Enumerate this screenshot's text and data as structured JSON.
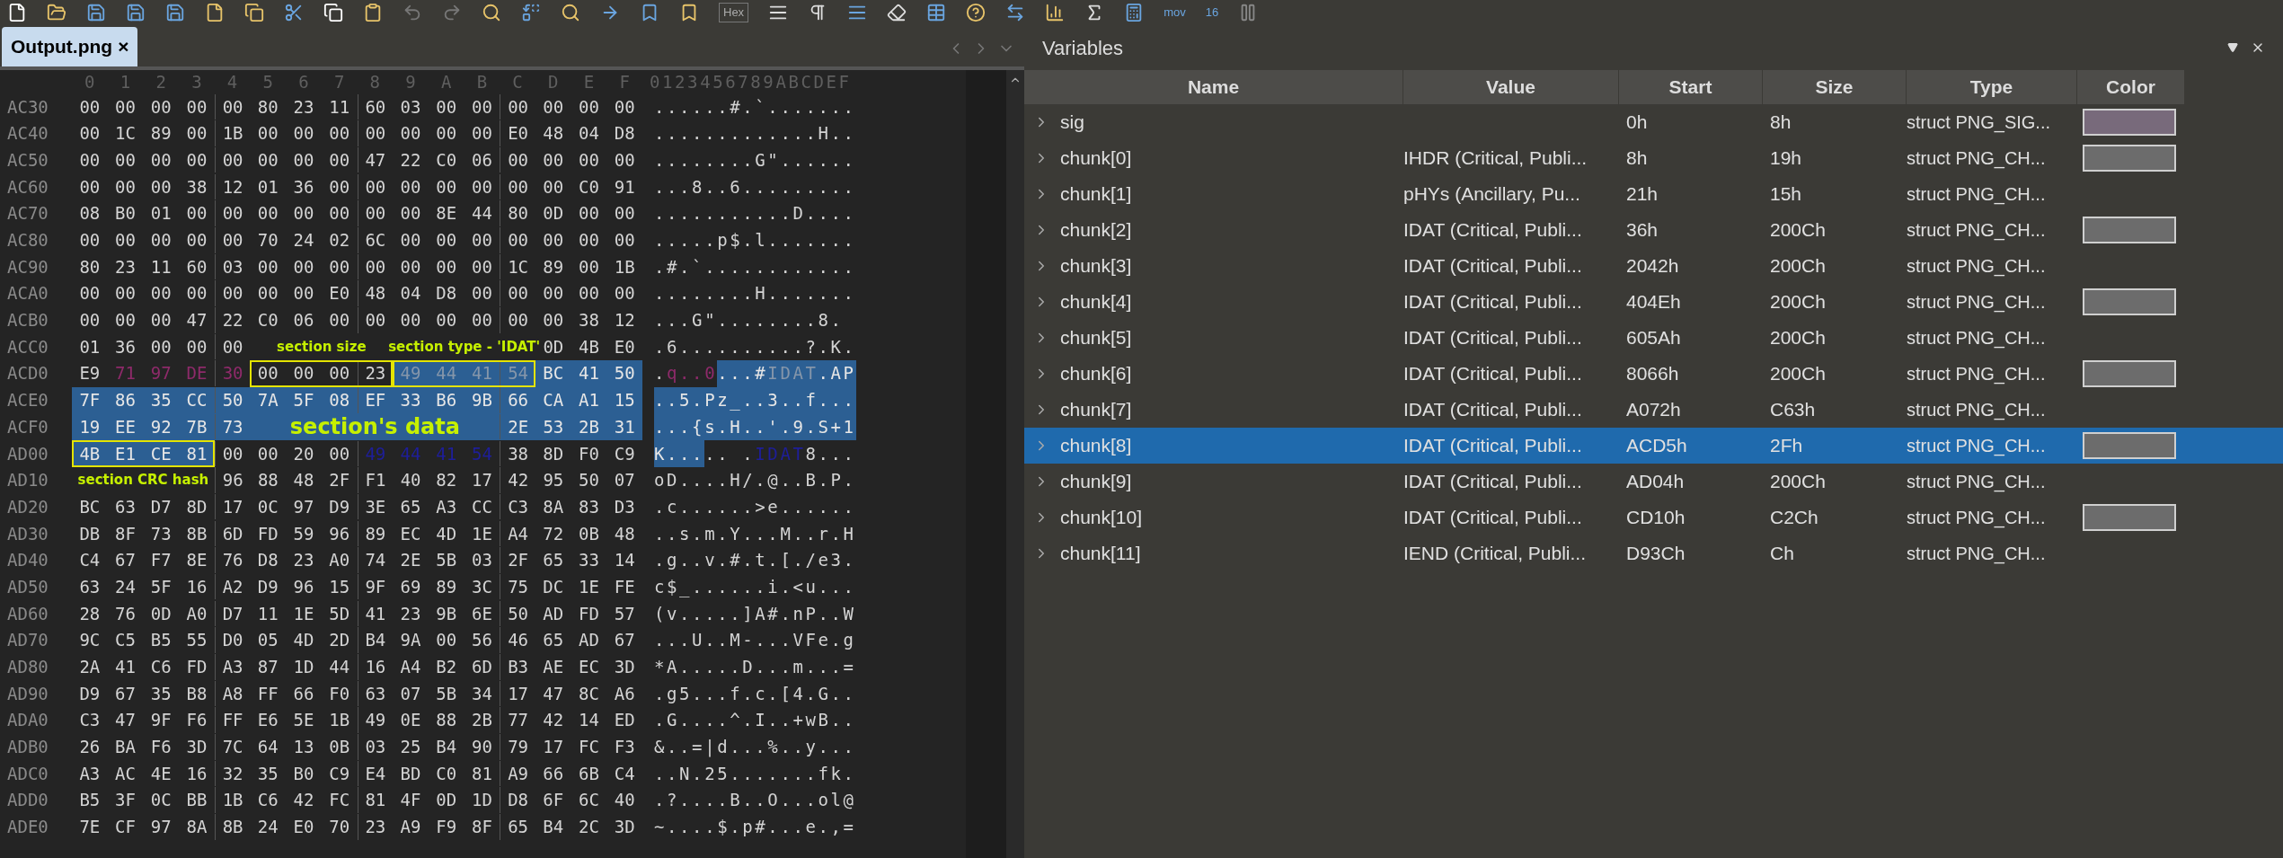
{
  "toolbar": {
    "labels": [
      "Hex",
      "mov",
      "16"
    ]
  },
  "tab": {
    "label": "Output.png",
    "close": "×",
    "selected": true
  },
  "hex_view": {
    "columns": [
      "0",
      "1",
      "2",
      "3",
      "4",
      "5",
      "6",
      "7",
      "8",
      "9",
      "A",
      "B",
      "C",
      "D",
      "E",
      "F"
    ],
    "ascii_header": "0123456789ABCDEF",
    "rows": [
      {
        "offset": "AC30",
        "segments": [
          {
            "kind": "plain",
            "bytes": [
              "00",
              "00",
              "00",
              "00",
              "00",
              "80",
              "23",
              "11",
              "60",
              "03",
              "00",
              "00",
              "00",
              "00",
              "00",
              "00"
            ]
          }
        ],
        "ascii": [
          {
            "kind": "plain",
            "text": "......#.`......."
          }
        ]
      },
      {
        "offset": "AC40",
        "segments": [
          {
            "kind": "plain",
            "bytes": [
              "00",
              "1C",
              "89",
              "00",
              "1B",
              "00",
              "00",
              "00",
              "00",
              "00",
              "00",
              "00",
              "E0",
              "48",
              "04",
              "D8"
            ]
          }
        ],
        "ascii": [
          {
            "kind": "plain",
            "text": ".............H.."
          }
        ]
      },
      {
        "offset": "AC50",
        "segments": [
          {
            "kind": "plain",
            "bytes": [
              "00",
              "00",
              "00",
              "00",
              "00",
              "00",
              "00",
              "00",
              "47",
              "22",
              "C0",
              "06",
              "00",
              "00",
              "00",
              "00"
            ]
          }
        ],
        "ascii": [
          {
            "kind": "plain",
            "text": "........G\"......"
          }
        ]
      },
      {
        "offset": "AC60",
        "segments": [
          {
            "kind": "plain",
            "bytes": [
              "00",
              "00",
              "00",
              "38",
              "12",
              "01",
              "36",
              "00",
              "00",
              "00",
              "00",
              "00",
              "00",
              "00",
              "C0",
              "91"
            ]
          }
        ],
        "ascii": [
          {
            "kind": "plain",
            "text": "...8..6........."
          }
        ]
      },
      {
        "offset": "AC70",
        "segments": [
          {
            "kind": "plain",
            "bytes": [
              "08",
              "B0",
              "01",
              "00",
              "00",
              "00",
              "00",
              "00",
              "00",
              "00",
              "8E",
              "44",
              "80",
              "0D",
              "00",
              "00"
            ]
          }
        ],
        "ascii": [
          {
            "kind": "plain",
            "text": "...........D...."
          }
        ]
      },
      {
        "offset": "AC80",
        "segments": [
          {
            "kind": "plain",
            "bytes": [
              "00",
              "00",
              "00",
              "00",
              "00",
              "70",
              "24",
              "02",
              "6C",
              "00",
              "00",
              "00",
              "00",
              "00",
              "00",
              "00"
            ]
          }
        ],
        "ascii": [
          {
            "kind": "plain",
            "text": ".....p$.l......."
          }
        ]
      },
      {
        "offset": "AC90",
        "segments": [
          {
            "kind": "plain",
            "bytes": [
              "80",
              "23",
              "11",
              "60",
              "03",
              "00",
              "00",
              "00",
              "00",
              "00",
              "00",
              "00",
              "1C",
              "89",
              "00",
              "1B"
            ]
          }
        ],
        "ascii": [
          {
            "kind": "plain",
            "text": ".#.`............"
          }
        ]
      },
      {
        "offset": "ACA0",
        "segments": [
          {
            "kind": "plain",
            "bytes": [
              "00",
              "00",
              "00",
              "00",
              "00",
              "00",
              "00",
              "E0",
              "48",
              "04",
              "D8",
              "00",
              "00",
              "00",
              "00",
              "00"
            ]
          }
        ],
        "ascii": [
          {
            "kind": "plain",
            "text": "........H......."
          }
        ]
      },
      {
        "offset": "ACB0",
        "segments": [
          {
            "kind": "plain",
            "bytes": [
              "00",
              "00",
              "00",
              "47",
              "22",
              "C0",
              "06",
              "00",
              "00",
              "00",
              "00",
              "00",
              "00",
              "00",
              "38",
              "12"
            ]
          }
        ],
        "ascii": [
          {
            "kind": "plain",
            "text": "...G\"........8."
          }
        ]
      },
      {
        "offset": "ACC0",
        "segments": [
          {
            "kind": "plain",
            "bytes": [
              "01",
              "36",
              "00",
              "00",
              "00"
            ]
          },
          {
            "kind": "label",
            "text": "section size"
          },
          {
            "kind": "label",
            "text": "section type - 'IDAT'"
          },
          {
            "kind": "plain",
            "bytes": [
              "0D",
              "4B",
              "E0"
            ]
          }
        ],
        "ascii": [
          {
            "kind": "plain",
            "text": ".6..........?.K."
          }
        ]
      },
      {
        "offset": "ACD0",
        "segments": [
          {
            "kind": "plain",
            "bytes": [
              "E9"
            ]
          },
          {
            "kind": "tagged",
            "bytes": [
              "71",
              "97",
              "DE",
              "30"
            ]
          },
          {
            "kind": "plain",
            "boxed": true,
            "bytes": [
              "00",
              "00",
              "00",
              "23"
            ]
          },
          {
            "kind": "selected-dim",
            "boxed": true,
            "bytes": [
              "49",
              "44",
              "41",
              "54"
            ]
          },
          {
            "kind": "selected",
            "bytes": [
              "BC",
              "41",
              "50"
            ]
          }
        ],
        "ascii": [
          {
            "kind": "plain",
            "text": "."
          },
          {
            "kind": "tagged",
            "text": "q..0"
          },
          {
            "kind": "selected",
            "text": "...#"
          },
          {
            "kind": "selected-dim",
            "text": "IDAT"
          },
          {
            "kind": "selected",
            "text": ".AP"
          }
        ]
      },
      {
        "offset": "ACE0",
        "segments": [
          {
            "kind": "selected",
            "bytes": [
              "7F",
              "86",
              "35",
              "CC",
              "50",
              "7A",
              "5F",
              "08",
              "EF",
              "33",
              "B6",
              "9B",
              "66",
              "CA",
              "A1",
              "15"
            ]
          }
        ],
        "ascii": [
          {
            "kind": "selected",
            "text": "..5.Pz_..3..f..."
          }
        ]
      },
      {
        "offset": "ACF0",
        "segments": [
          {
            "kind": "selected",
            "bytes": [
              "19",
              "EE",
              "92",
              "7B",
              "73"
            ]
          },
          {
            "kind": "label-large",
            "text": "section's data"
          },
          {
            "kind": "selected",
            "bytes": [
              "2E",
              "53",
              "2B",
              "31"
            ]
          }
        ],
        "ascii": [
          {
            "kind": "selected",
            "text": "...{s.H..'.9.S+1"
          }
        ]
      },
      {
        "offset": "AD00",
        "segments": [
          {
            "kind": "selected",
            "boxed": true,
            "bytes": [
              "4B",
              "E1",
              "CE",
              "81"
            ]
          },
          {
            "kind": "plain",
            "bytes": [
              "00",
              "00",
              "20",
              "00"
            ]
          },
          {
            "kind": "marked",
            "bytes": [
              "49",
              "44",
              "41",
              "54"
            ]
          },
          {
            "kind": "plain",
            "bytes": [
              "38",
              "8D",
              "F0",
              "C9"
            ]
          }
        ],
        "ascii": [
          {
            "kind": "selected",
            "text": "K..."
          },
          {
            "kind": "plain",
            "text": ".. ."
          },
          {
            "kind": "marked",
            "text": "IDAT"
          },
          {
            "kind": "plain",
            "text": "8..."
          }
        ]
      },
      {
        "offset": "AD10",
        "segments": [
          {
            "kind": "label",
            "text": "section CRC hash"
          },
          {
            "kind": "plain",
            "bytes": [
              "96",
              "88",
              "48",
              "2F",
              "F1",
              "40",
              "82",
              "17",
              "42",
              "95",
              "50",
              "07"
            ]
          }
        ],
        "ascii": [
          {
            "kind": "plain",
            "text": "oD....H/.@..B.P."
          }
        ]
      },
      {
        "offset": "AD20",
        "segments": [
          {
            "kind": "plain",
            "bytes": [
              "BC",
              "63",
              "D7",
              "8D",
              "17",
              "0C",
              "97",
              "D9",
              "3E",
              "65",
              "A3",
              "CC",
              "C3",
              "8A",
              "83",
              "D3"
            ]
          }
        ],
        "ascii": [
          {
            "kind": "plain",
            "text": ".c......>e......"
          }
        ]
      },
      {
        "offset": "AD30",
        "segments": [
          {
            "kind": "plain",
            "bytes": [
              "DB",
              "8F",
              "73",
              "8B",
              "6D",
              "FD",
              "59",
              "96",
              "89",
              "EC",
              "4D",
              "1E",
              "A4",
              "72",
              "0B",
              "48"
            ]
          }
        ],
        "ascii": [
          {
            "kind": "plain",
            "text": "..s.m.Y...M..r.H"
          }
        ]
      },
      {
        "offset": "AD40",
        "segments": [
          {
            "kind": "plain",
            "bytes": [
              "C4",
              "67",
              "F7",
              "8E",
              "76",
              "D8",
              "23",
              "A0",
              "74",
              "2E",
              "5B",
              "03",
              "2F",
              "65",
              "33",
              "14"
            ]
          }
        ],
        "ascii": [
          {
            "kind": "plain",
            "text": ".g..v.#.t.[./e3."
          }
        ]
      },
      {
        "offset": "AD50",
        "segments": [
          {
            "kind": "plain",
            "bytes": [
              "63",
              "24",
              "5F",
              "16",
              "A2",
              "D9",
              "96",
              "15",
              "9F",
              "69",
              "89",
              "3C",
              "75",
              "DC",
              "1E",
              "FE"
            ]
          }
        ],
        "ascii": [
          {
            "kind": "plain",
            "text": "c$_......i.<u..."
          }
        ]
      },
      {
        "offset": "AD60",
        "segments": [
          {
            "kind": "plain",
            "bytes": [
              "28",
              "76",
              "0D",
              "A0",
              "D7",
              "11",
              "1E",
              "5D",
              "41",
              "23",
              "9B",
              "6E",
              "50",
              "AD",
              "FD",
              "57"
            ]
          }
        ],
        "ascii": [
          {
            "kind": "plain",
            "text": "(v.....]A#.nP..W"
          }
        ]
      },
      {
        "offset": "AD70",
        "segments": [
          {
            "kind": "plain",
            "bytes": [
              "9C",
              "C5",
              "B5",
              "55",
              "D0",
              "05",
              "4D",
              "2D",
              "B4",
              "9A",
              "00",
              "56",
              "46",
              "65",
              "AD",
              "67"
            ]
          }
        ],
        "ascii": [
          {
            "kind": "plain",
            "text": "...U..M-...VFe.g"
          }
        ]
      },
      {
        "offset": "AD80",
        "segments": [
          {
            "kind": "plain",
            "bytes": [
              "2A",
              "41",
              "C6",
              "FD",
              "A3",
              "87",
              "1D",
              "44",
              "16",
              "A4",
              "B2",
              "6D",
              "B3",
              "AE",
              "EC",
              "3D"
            ]
          }
        ],
        "ascii": [
          {
            "kind": "plain",
            "text": "*A.....D...m...="
          }
        ]
      },
      {
        "offset": "AD90",
        "segments": [
          {
            "kind": "plain",
            "bytes": [
              "D9",
              "67",
              "35",
              "B8",
              "A8",
              "FF",
              "66",
              "F0",
              "63",
              "07",
              "5B",
              "34",
              "17",
              "47",
              "8C",
              "A6"
            ]
          }
        ],
        "ascii": [
          {
            "kind": "plain",
            "text": ".g5...f.c.[4.G.."
          }
        ]
      },
      {
        "offset": "ADA0",
        "segments": [
          {
            "kind": "plain",
            "bytes": [
              "C3",
              "47",
              "9F",
              "F6",
              "FF",
              "E6",
              "5E",
              "1B",
              "49",
              "0E",
              "88",
              "2B",
              "77",
              "42",
              "14",
              "ED"
            ]
          }
        ],
        "ascii": [
          {
            "kind": "plain",
            "text": ".G....^.I..+wB.."
          }
        ]
      },
      {
        "offset": "ADB0",
        "segments": [
          {
            "kind": "plain",
            "bytes": [
              "26",
              "BA",
              "F6",
              "3D",
              "7C",
              "64",
              "13",
              "0B",
              "03",
              "25",
              "B4",
              "90",
              "79",
              "17",
              "FC",
              "F3"
            ]
          }
        ],
        "ascii": [
          {
            "kind": "plain",
            "text": "&..=|d...%..y..."
          }
        ]
      },
      {
        "offset": "ADC0",
        "segments": [
          {
            "kind": "plain",
            "bytes": [
              "A3",
              "AC",
              "4E",
              "16",
              "32",
              "35",
              "B0",
              "C9",
              "E4",
              "BD",
              "C0",
              "81",
              "A9",
              "66",
              "6B",
              "C4"
            ]
          }
        ],
        "ascii": [
          {
            "kind": "plain",
            "text": "..N.25.......fk."
          }
        ]
      },
      {
        "offset": "ADD0",
        "segments": [
          {
            "kind": "plain",
            "bytes": [
              "B5",
              "3F",
              "0C",
              "BB",
              "1B",
              "C6",
              "42",
              "FC",
              "81",
              "4F",
              "0D",
              "1D",
              "D8",
              "6F",
              "6C",
              "40"
            ]
          }
        ],
        "ascii": [
          {
            "kind": "plain",
            "text": ".?....B..O...ol@"
          }
        ]
      },
      {
        "offset": "ADE0",
        "segments": [
          {
            "kind": "plain",
            "bytes": [
              "7E",
              "CF",
              "97",
              "8A",
              "8B",
              "24",
              "E0",
              "70",
              "23",
              "A9",
              "F9",
              "8F",
              "65",
              "B4",
              "2C",
              "3D"
            ]
          }
        ],
        "ascii": [
          {
            "kind": "plain",
            "text": "~....$.p#...e.,="
          }
        ]
      }
    ]
  },
  "variables": {
    "title": "Variables",
    "columns": [
      "Name",
      "Value",
      "Start",
      "Size",
      "Type",
      "Color"
    ],
    "rows": [
      {
        "name": "sig",
        "value": "",
        "start": "0h",
        "size": "8h",
        "type": "struct PNG_SIG...",
        "expanded": false,
        "selected": false,
        "color": "#786a7b"
      },
      {
        "name": "chunk[0]",
        "value": "IHDR  (Critical, Publi...",
        "start": "8h",
        "size": "19h",
        "type": "struct PNG_CH...",
        "expanded": false,
        "selected": false,
        "color": "#6c6c6c"
      },
      {
        "name": "chunk[1]",
        "value": "pHYs  (Ancillary, Pu...",
        "start": "21h",
        "size": "15h",
        "type": "struct PNG_CH...",
        "expanded": false,
        "selected": false
      },
      {
        "name": "chunk[2]",
        "value": "IDAT  (Critical, Publi...",
        "start": "36h",
        "size": "200Ch",
        "type": "struct PNG_CH...",
        "expanded": false,
        "selected": false,
        "color": "#6c6c6c"
      },
      {
        "name": "chunk[3]",
        "value": "IDAT  (Critical, Publi...",
        "start": "2042h",
        "size": "200Ch",
        "type": "struct PNG_CH...",
        "expanded": false,
        "selected": false
      },
      {
        "name": "chunk[4]",
        "value": "IDAT  (Critical, Publi...",
        "start": "404Eh",
        "size": "200Ch",
        "type": "struct PNG_CH...",
        "expanded": false,
        "selected": false,
        "color": "#6c6c6c"
      },
      {
        "name": "chunk[5]",
        "value": "IDAT  (Critical, Publi...",
        "start": "605Ah",
        "size": "200Ch",
        "type": "struct PNG_CH...",
        "expanded": false,
        "selected": false
      },
      {
        "name": "chunk[6]",
        "value": "IDAT  (Critical, Publi...",
        "start": "8066h",
        "size": "200Ch",
        "type": "struct PNG_CH...",
        "expanded": false,
        "selected": false,
        "color": "#6c6c6c"
      },
      {
        "name": "chunk[7]",
        "value": "IDAT  (Critical, Publi...",
        "start": "A072h",
        "size": "C63h",
        "type": "struct PNG_CH...",
        "expanded": false,
        "selected": false
      },
      {
        "name": "chunk[8]",
        "value": "IDAT  (Critical, Publi...",
        "start": "ACD5h",
        "size": "2Fh",
        "type": "struct PNG_CH...",
        "expanded": false,
        "selected": true,
        "color": "#6c6c6c"
      },
      {
        "name": "chunk[9]",
        "value": "IDAT  (Critical, Publi...",
        "start": "AD04h",
        "size": "200Ch",
        "type": "struct PNG_CH...",
        "expanded": false,
        "selected": false
      },
      {
        "name": "chunk[10]",
        "value": "IDAT  (Critical, Publi...",
        "start": "CD10h",
        "size": "C2Ch",
        "type": "struct PNG_CH...",
        "expanded": false,
        "selected": false,
        "color": "#6c6c6c"
      },
      {
        "name": "chunk[11]",
        "value": "IEND  (Critical, Publi...",
        "start": "D93Ch",
        "size": "Ch",
        "type": "struct PNG_CH...",
        "expanded": false,
        "selected": false
      }
    ]
  }
}
